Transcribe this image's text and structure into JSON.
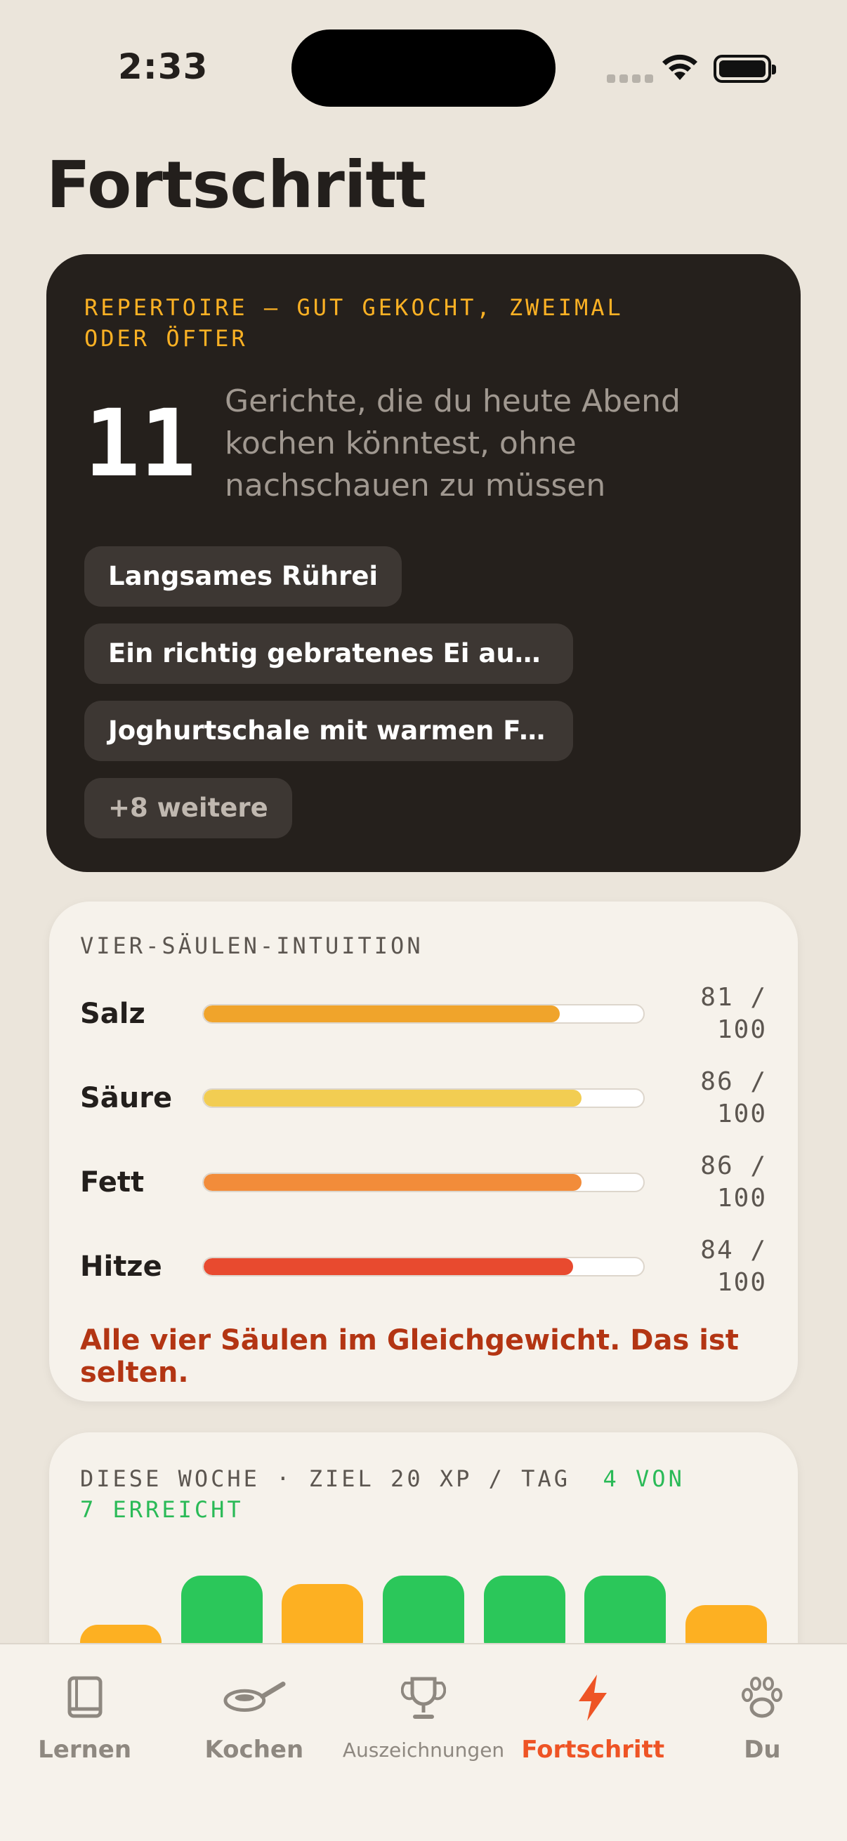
{
  "status": {
    "time": "2:33"
  },
  "page": {
    "title": "Fortschritt"
  },
  "repertoire": {
    "eyebrow": "REPERTOIRE — GUT GEKOCHT, ZWEIMAL ODER ÖFTER",
    "count": "11",
    "description": "Gerichte, die du heute Abend kochen könntest, ohne nachschauen zu müssen",
    "dishes": [
      "Langsames Rührei",
      "Ein richtig gebratenes Ei auf Toast",
      "Joghurtschale mit warmen Früchten"
    ],
    "more_label": "+8 weitere"
  },
  "pillars": {
    "eyebrow": "VIER-SÄULEN-INTUITION",
    "items": [
      {
        "name": "Salz",
        "value": 81,
        "max": 100,
        "label": "81 / 100",
        "color": "#f0a42b"
      },
      {
        "name": "Säure",
        "value": 86,
        "max": 100,
        "label": "86 / 100",
        "color": "#f2cd52"
      },
      {
        "name": "Fett",
        "value": 86,
        "max": 100,
        "label": "86 / 100",
        "color": "#f28c3a"
      },
      {
        "name": "Hitze",
        "value": 84,
        "max": 100,
        "label": "84 / 100",
        "color": "#e84a2f"
      }
    ],
    "note": "Alle vier Säulen im Gleichgewicht. Das ist selten."
  },
  "week": {
    "eyebrow": "DIESE WOCHE · ZIEL 20 XP / TAG",
    "achieved": "4 VON 7 ERREICHT",
    "days": [
      {
        "level": 0.42,
        "goal_met": false
      },
      {
        "level": 1.0,
        "goal_met": true
      },
      {
        "level": 0.9,
        "goal_met": false
      },
      {
        "level": 1.0,
        "goal_met": true
      },
      {
        "level": 1.0,
        "goal_met": true
      },
      {
        "level": 1.0,
        "goal_met": true
      },
      {
        "level": 0.65,
        "goal_met": false
      }
    ],
    "colors": {
      "met": "#2bc75a",
      "partial": "#fdb022"
    }
  },
  "tabs": [
    {
      "label": "Lernen",
      "icon": "book-icon",
      "active": false
    },
    {
      "label": "Kochen",
      "icon": "pan-icon",
      "active": false
    },
    {
      "label": "Auszeichnungen",
      "icon": "trophy-icon",
      "active": false
    },
    {
      "label": "Fortschritt",
      "icon": "bolt-icon",
      "active": true
    },
    {
      "label": "Du",
      "icon": "paw-icon",
      "active": false
    }
  ],
  "colors": {
    "accent": "#ee5425",
    "eyebrow_gold": "#fbb124",
    "success": "#2aba57"
  }
}
